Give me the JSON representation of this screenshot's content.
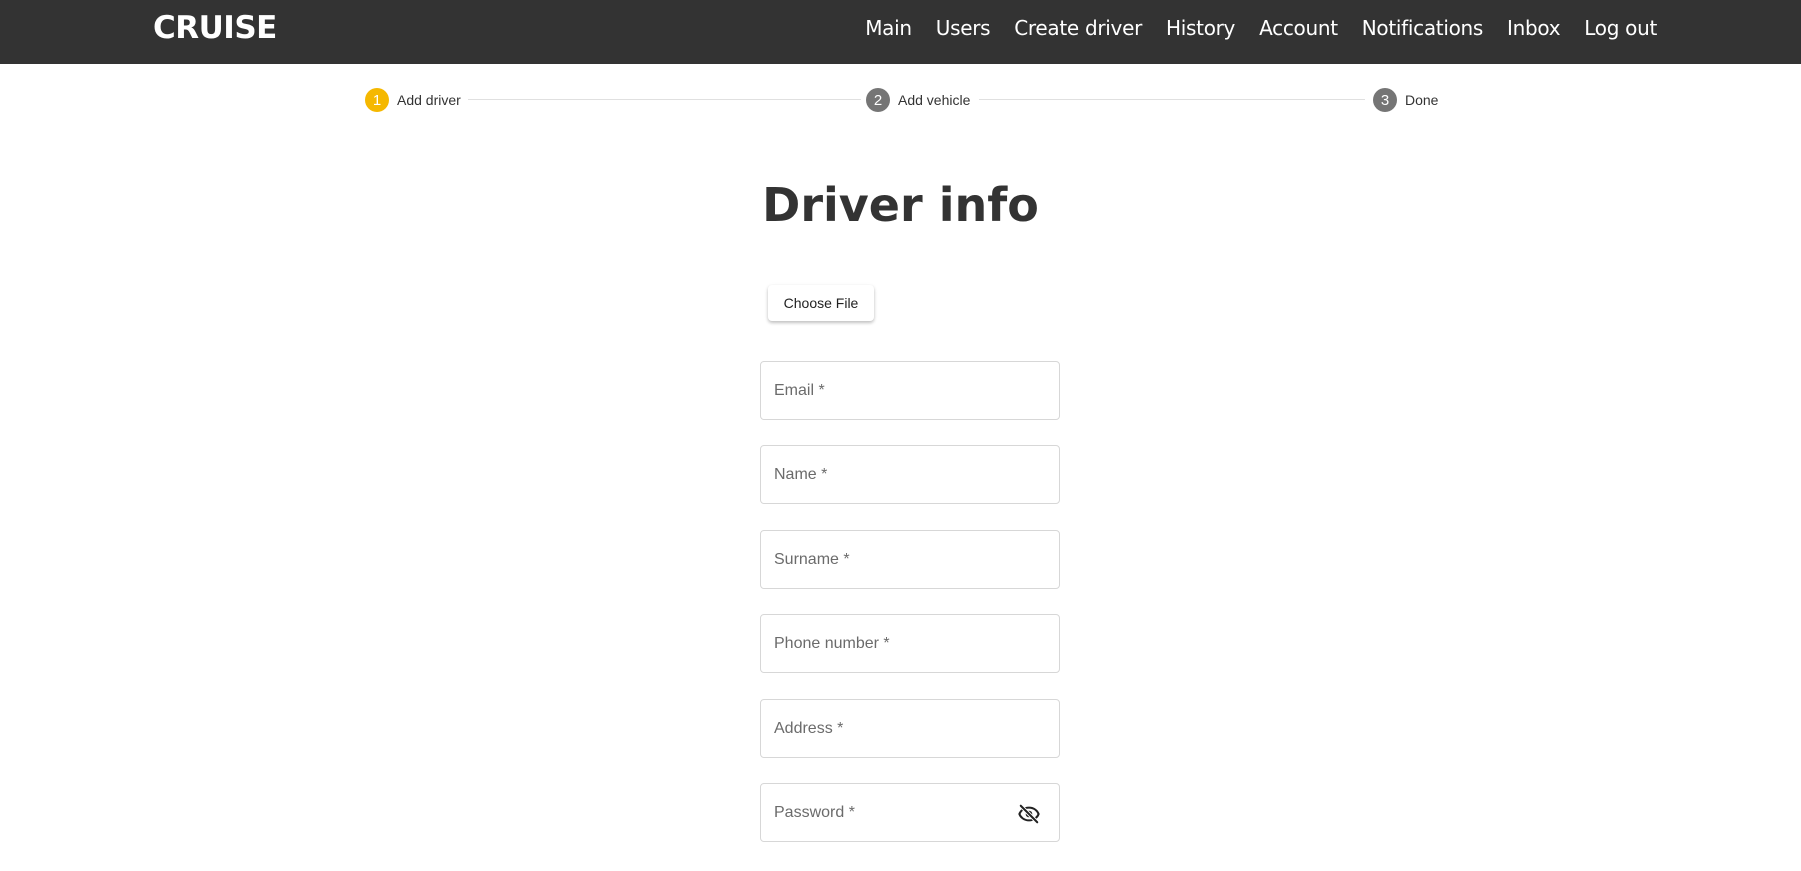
{
  "header": {
    "logo": "CRUISE",
    "nav": [
      "Main",
      "Users",
      "Create driver",
      "History",
      "Account",
      "Notifications",
      "Inbox",
      "Log out"
    ]
  },
  "stepper": {
    "steps": [
      {
        "number": "1",
        "label": "Add driver",
        "state": "active"
      },
      {
        "number": "2",
        "label": "Add vehicle",
        "state": "inactive"
      },
      {
        "number": "3",
        "label": "Done",
        "state": "inactive"
      }
    ],
    "active_color": "#f5b800",
    "inactive_color": "#757575"
  },
  "form": {
    "title": "Driver info",
    "file_button": "Choose File",
    "fields": [
      {
        "placeholder": "Email *",
        "value": ""
      },
      {
        "placeholder": "Name *",
        "value": ""
      },
      {
        "placeholder": "Surname *",
        "value": ""
      },
      {
        "placeholder": "Phone number *",
        "value": ""
      },
      {
        "placeholder": "Address *",
        "value": ""
      },
      {
        "placeholder": "Password *",
        "value": ""
      }
    ],
    "password_toggle_icon": "visibility-off-icon"
  },
  "colors": {
    "navbar_bg": "#333333",
    "accent": "#f5b800"
  }
}
